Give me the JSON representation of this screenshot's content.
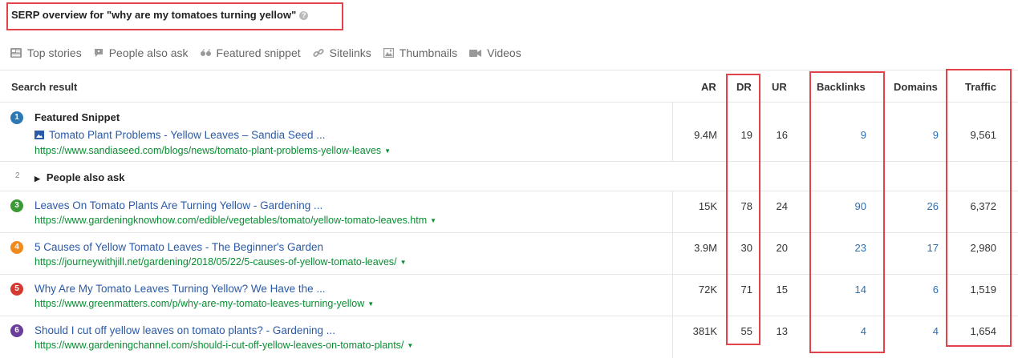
{
  "header": {
    "title": "SERP overview for \"why are my tomatoes turning yellow\"",
    "help_icon": "?"
  },
  "features": [
    {
      "label": "Top stories",
      "icon": "newspaper-icon"
    },
    {
      "label": "People also ask",
      "icon": "comment-icon"
    },
    {
      "label": "Featured snippet",
      "icon": "quote-icon"
    },
    {
      "label": "Sitelinks",
      "icon": "link-icon"
    },
    {
      "label": "Thumbnails",
      "icon": "image-icon"
    },
    {
      "label": "Videos",
      "icon": "video-icon"
    }
  ],
  "columns": {
    "search_result": "Search result",
    "ar": "AR",
    "dr": "DR",
    "ur": "UR",
    "backlinks": "Backlinks",
    "domains": "Domains",
    "traffic": "Traffic"
  },
  "rows": [
    {
      "pos": "1",
      "badge_color": "#2e77b5",
      "label": "Featured Snippet",
      "title": "Tomato Plant Problems - Yellow Leaves – Sandia Seed ...",
      "url": "https://www.sandiaseed.com/blogs/news/tomato-plant-problems-yellow-leaves",
      "ar": "9.4M",
      "dr": "19",
      "ur": "16",
      "backlinks": "9",
      "domains": "9",
      "traffic": "9,561"
    },
    {
      "pos": "2",
      "label": "People also ask"
    },
    {
      "pos": "3",
      "badge_color": "#3a9b35",
      "title": "Leaves On Tomato Plants Are Turning Yellow - Gardening ...",
      "url": "https://www.gardeningknowhow.com/edible/vegetables/tomato/yellow-tomato-leaves.htm",
      "ar": "15K",
      "dr": "78",
      "ur": "24",
      "backlinks": "90",
      "domains": "26",
      "traffic": "6,372"
    },
    {
      "pos": "4",
      "badge_color": "#f08a1d",
      "title": "5 Causes of Yellow Tomato Leaves - The Beginner's Garden",
      "url": "https://journeywithjill.net/gardening/2018/05/22/5-causes-of-yellow-tomato-leaves/",
      "ar": "3.9M",
      "dr": "30",
      "ur": "20",
      "backlinks": "23",
      "domains": "17",
      "traffic": "2,980"
    },
    {
      "pos": "5",
      "badge_color": "#d43a2f",
      "title": "Why Are My Tomato Leaves Turning Yellow? We Have the ...",
      "url": "https://www.greenmatters.com/p/why-are-my-tomato-leaves-turning-yellow",
      "ar": "72K",
      "dr": "71",
      "ur": "15",
      "backlinks": "14",
      "domains": "6",
      "traffic": "1,519"
    },
    {
      "pos": "6",
      "badge_color": "#6a3d9a",
      "title": "Should I cut off yellow leaves on tomato plants? - Gardening ...",
      "url": "https://www.gardeningchannel.com/should-i-cut-off-yellow-leaves-on-tomato-plants/",
      "ar": "381K",
      "dr": "55",
      "ur": "13",
      "backlinks": "4",
      "domains": "4",
      "traffic": "1,654"
    }
  ]
}
